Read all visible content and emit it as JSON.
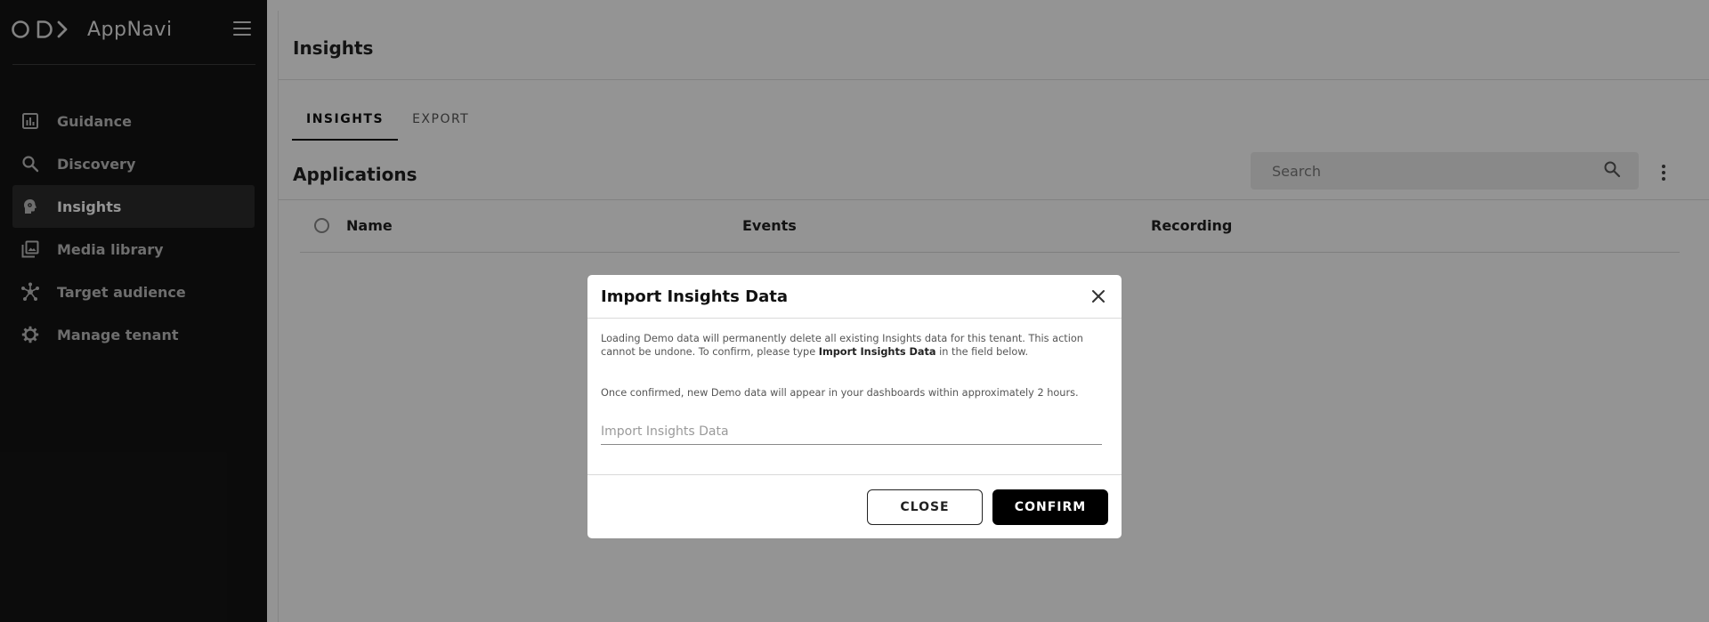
{
  "app": {
    "name": "AppNavi"
  },
  "sidebar": {
    "items": [
      {
        "label": "Guidance",
        "icon": "bar-chart-icon"
      },
      {
        "label": "Discovery",
        "icon": "search-icon"
      },
      {
        "label": "Insights",
        "icon": "head-gear-icon",
        "active": true
      },
      {
        "label": "Media library",
        "icon": "media-library-icon"
      },
      {
        "label": "Target audience",
        "icon": "network-icon"
      },
      {
        "label": "Manage tenant",
        "icon": "gear-icon"
      }
    ]
  },
  "header": {
    "title": "Insights"
  },
  "tabs": [
    {
      "label": "INSIGHTS",
      "active": true
    },
    {
      "label": "EXPORT",
      "active": false
    }
  ],
  "applications": {
    "title": "Applications",
    "search_placeholder": "Search",
    "columns": [
      "Name",
      "Events",
      "Recording"
    ]
  },
  "modal": {
    "title": "Import Insights Data",
    "text1_pre": "Loading Demo data will permanently delete all existing Insights data for this tenant. This action cannot be undone. To confirm, please type ",
    "text1_bold": "Import Insights Data",
    "text1_post": " in the field below.",
    "text2": "Once confirmed, new Demo data will appear in your dashboards within approximately 2 hours.",
    "input_placeholder": "Import Insights Data",
    "close_label": "CLOSE",
    "confirm_label": "CONFIRM"
  },
  "colors": {
    "sidebar_bg": "#141414",
    "primary": "#000000",
    "overlay": "rgba(0,0,0,0.42)"
  }
}
